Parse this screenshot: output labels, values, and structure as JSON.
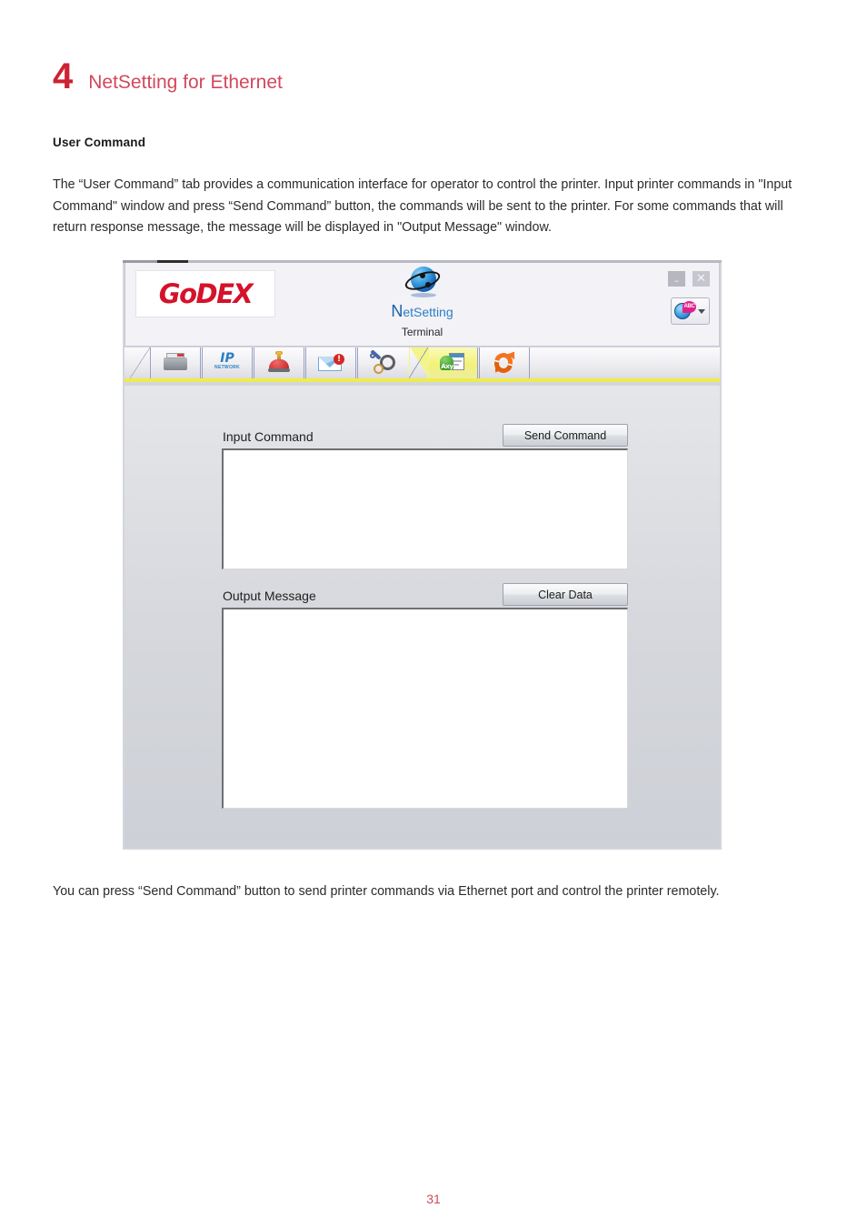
{
  "document": {
    "chapter_number": "4",
    "chapter_title": "NetSetting for Ethernet",
    "section_heading": "User Command",
    "intro_paragraph": "The “User Command” tab provides a communication interface for operator to control the printer. Input printer commands in \"Input Command\" window and press “Send Command” button, the commands will be sent to the printer.\nFor some commands that will return response message, the message will be displayed in \"Output Message\" window.",
    "outro_paragraph": "You can press “Send Command” button to send printer commands via Ethernet port and control the printer remotely.",
    "page_number": "31",
    "accent_color": "#cc2233",
    "title_color": "#d2485c"
  },
  "app": {
    "brand_logo": "GoDEX",
    "product_name": "NetSetting",
    "screen_name": "Terminal",
    "window_controls": {
      "minimize": "–",
      "close": "✕"
    },
    "language_selector": {
      "icon": "globe-abc-icon",
      "badge": "ABC"
    },
    "tabs": [
      {
        "id": "printer",
        "icon": "printer-icon",
        "active": false
      },
      {
        "id": "network",
        "icon": "ip-network-icon",
        "active": false,
        "label_top": "IP",
        "label_bottom": "NETWORK"
      },
      {
        "id": "alert",
        "icon": "alarm-icon",
        "active": false
      },
      {
        "id": "mail",
        "icon": "mail-alert-icon",
        "active": false,
        "badge": "!"
      },
      {
        "id": "tools",
        "icon": "wrench-gears-icon",
        "active": false
      },
      {
        "id": "command",
        "icon": "user-command-icon",
        "active": true,
        "badge": "Axy"
      },
      {
        "id": "refresh",
        "icon": "refresh-icon",
        "active": false
      }
    ],
    "form": {
      "input_label": "Input Command",
      "input_value": "",
      "send_button": "Send Command",
      "output_label": "Output Message",
      "output_value": "",
      "clear_button": "Clear Data"
    }
  }
}
